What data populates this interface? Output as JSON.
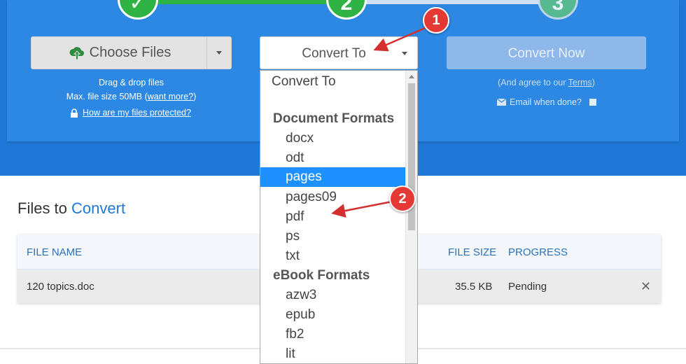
{
  "steps": [
    "✓",
    "2",
    "3"
  ],
  "choose_files": {
    "label": "Choose Files"
  },
  "hints": {
    "drag_drop": "Drag & drop files",
    "max_size_prefix": "Max. file size 50MB (",
    "want_more": "want more?",
    "max_size_suffix": ")",
    "protected": "How are my files protected?"
  },
  "convert_to": {
    "label": "Convert To"
  },
  "convert_now": {
    "label": "Convert Now",
    "agree_prefix": "(And agree to our ",
    "terms": "Terms",
    "agree_suffix": ")",
    "email": "Email when done?"
  },
  "dropdown": {
    "placeholder": "Convert To",
    "groups": [
      {
        "label": "Document Formats",
        "options": [
          "docx",
          "odt",
          "pages",
          "pages09",
          "pdf",
          "ps",
          "txt"
        ]
      },
      {
        "label": "eBook Formats",
        "options": [
          "azw3",
          "epub",
          "fb2",
          "lit"
        ]
      }
    ],
    "selected": "pages"
  },
  "files_section": {
    "title_prefix": "Files to",
    "title_highlight": "Convert",
    "columns": [
      "FILE NAME",
      "FILE SIZE",
      "PROGRESS"
    ],
    "rows": [
      {
        "name": "120 topics.doc",
        "size": "35.5 KB",
        "progress": "Pending"
      }
    ]
  },
  "annotations": [
    "1",
    "2"
  ],
  "colors": {
    "brand_blue": "#1f78d8",
    "panel_blue": "#2c88e3",
    "step_green": "#2fb344",
    "selected_option": "#1e90ff",
    "badge_red": "#e53935"
  }
}
